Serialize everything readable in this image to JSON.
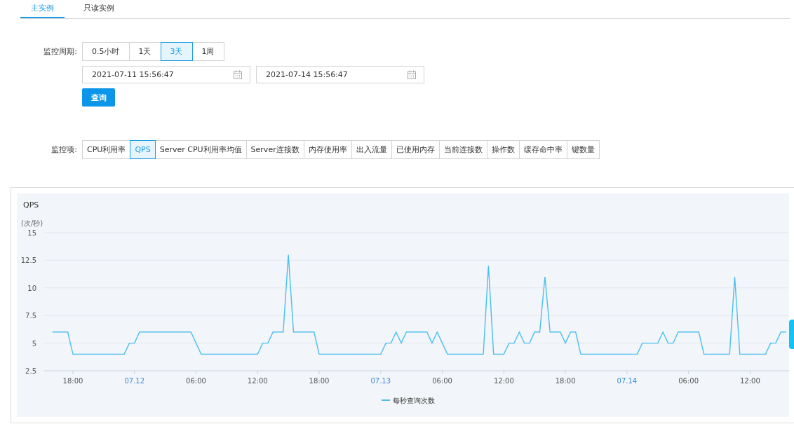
{
  "tabs": [
    {
      "label": "主实例",
      "selected": true
    },
    {
      "label": "只读实例",
      "selected": false
    }
  ],
  "period": {
    "label": "监控周期:",
    "options": [
      {
        "label": "0.5小时",
        "selected": false
      },
      {
        "label": "1天",
        "selected": false
      },
      {
        "label": "3天",
        "selected": true
      },
      {
        "label": "1周",
        "selected": false
      }
    ],
    "start": "2021-07-11 15:56:47",
    "end": "2021-07-14 15:56:47",
    "query_button": "查询"
  },
  "metrics": {
    "label": "监控项:",
    "options": [
      {
        "label": "CPU利用率",
        "selected": false
      },
      {
        "label": "QPS",
        "selected": true
      },
      {
        "label": "Server CPU利用率均值",
        "selected": false
      },
      {
        "label": "Server连接数",
        "selected": false
      },
      {
        "label": "内存使用率",
        "selected": false
      },
      {
        "label": "出入流量",
        "selected": false
      },
      {
        "label": "已使用内存",
        "selected": false
      },
      {
        "label": "当前连接数",
        "selected": false
      },
      {
        "label": "操作数",
        "selected": false
      },
      {
        "label": "缓存命中率",
        "selected": false
      },
      {
        "label": "键数量",
        "selected": false
      }
    ]
  },
  "chart": {
    "chart_data": {
      "type": "line",
      "title": "QPS",
      "ylabel": "(次/秒)",
      "categories": [
        null,
        null,
        null,
        null,
        "18:00",
        null,
        null,
        null,
        null,
        null,
        null,
        null,
        null,
        null,
        null,
        null,
        "07.12",
        null,
        null,
        null,
        null,
        null,
        null,
        null,
        null,
        null,
        null,
        null,
        "06:00",
        null,
        null,
        null,
        null,
        null,
        null,
        null,
        null,
        null,
        null,
        null,
        "12:00",
        null,
        null,
        null,
        null,
        null,
        null,
        null,
        null,
        null,
        null,
        null,
        "18:00",
        null,
        null,
        null,
        null,
        null,
        null,
        null,
        null,
        null,
        null,
        null,
        "07.13",
        null,
        null,
        null,
        null,
        null,
        null,
        null,
        null,
        null,
        null,
        null,
        "06:00",
        null,
        null,
        null,
        null,
        null,
        null,
        null,
        null,
        null,
        null,
        null,
        "12:00",
        null,
        null,
        null,
        null,
        null,
        null,
        null,
        null,
        null,
        null,
        null,
        "18:00",
        null,
        null,
        null,
        null,
        null,
        null,
        null,
        null,
        null,
        null,
        null,
        "07.14",
        null,
        null,
        null,
        null,
        null,
        null,
        null,
        null,
        null,
        null,
        null,
        "06:00",
        null,
        null,
        null,
        null,
        null,
        null,
        null,
        null,
        null,
        null,
        null,
        "12:00",
        null,
        null,
        null,
        null,
        null,
        null,
        null
      ],
      "series": [
        {
          "name": "每秒查询次数",
          "color": "#4bbfee",
          "values": [
            6,
            6,
            6,
            6,
            4,
            4,
            4,
            4,
            4,
            4,
            4,
            4,
            4,
            4,
            4,
            5,
            5,
            6,
            6,
            6,
            6,
            6,
            6,
            6,
            6,
            6,
            6,
            6,
            5,
            4,
            4,
            4,
            4,
            4,
            4,
            4,
            4,
            4,
            4,
            4,
            4,
            5,
            5,
            6,
            6,
            6,
            13,
            6,
            6,
            6,
            6,
            6,
            4,
            4,
            4,
            4,
            4,
            4,
            4,
            4,
            4,
            4,
            4,
            4,
            4,
            5,
            5,
            6,
            5,
            6,
            6,
            6,
            6,
            6,
            5,
            6,
            5,
            4,
            4,
            4,
            4,
            4,
            4,
            4,
            4,
            12,
            4,
            4,
            4,
            5,
            5,
            6,
            5,
            5,
            6,
            6,
            11,
            6,
            6,
            6,
            5,
            6,
            6,
            4,
            4,
            4,
            4,
            4,
            4,
            4,
            4,
            4,
            4,
            4,
            4,
            5,
            5,
            5,
            5,
            6,
            5,
            5,
            6,
            6,
            6,
            6,
            6,
            4,
            4,
            4,
            4,
            4,
            4,
            11,
            4,
            4,
            4,
            4,
            4,
            4,
            5,
            5,
            6,
            6
          ]
        }
      ],
      "ylim": [
        2.5,
        15
      ],
      "grid": true,
      "yticks": [
        {
          "value": 2.5,
          "label": "2.5"
        },
        {
          "value": 5,
          "label": "5"
        },
        {
          "value": 7.5,
          "label": "7.5"
        },
        {
          "value": 10,
          "label": "10"
        },
        {
          "value": 12.5,
          "label": "12.5"
        },
        {
          "value": 15,
          "label": "15"
        }
      ]
    }
  }
}
